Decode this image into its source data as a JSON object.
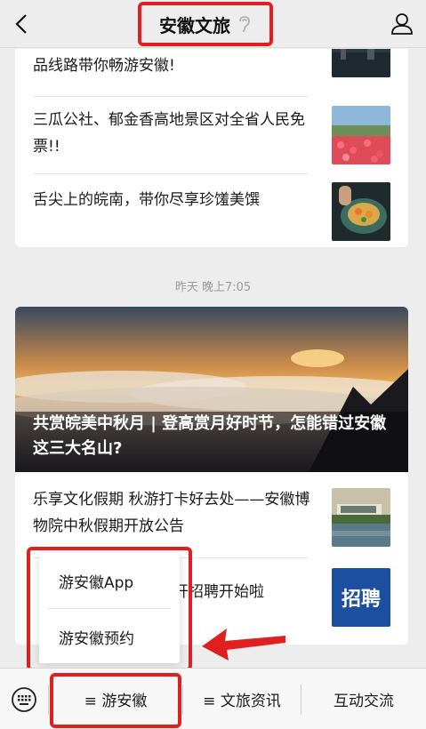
{
  "header": {
    "title": "安徽文旅",
    "back_icon": "chevron-left-icon",
    "ear_icon": "ear-icon",
    "profile_icon": "person-icon"
  },
  "card_top": {
    "items": [
      {
        "title": "品线路带你畅游安徽!"
      },
      {
        "title": "三瓜公社、郁金香高地景区对全省人民免票!!"
      },
      {
        "title": "舌尖上的皖南，带你尽享珍馐美馔"
      }
    ]
  },
  "timestamp": "昨天 晚上7:05",
  "card_main": {
    "hero_title": "共赏皖美中秋月 | 登高赏月好时节，怎能错过安徽这三大名山?",
    "items": [
      {
        "title": "乐享文化假期 秋游打卡好去处——安徽博物院中秋假期开放公告"
      },
      {
        "title": "馆公开招聘开始啦",
        "thumb_text": "招聘"
      }
    ]
  },
  "popup": {
    "items": [
      "游安徽App",
      "游安徽预约"
    ]
  },
  "bottombar": {
    "keyboard_icon": "keyboard-icon",
    "tabs": [
      "≡ 游安徽",
      "≡ 文旅资讯",
      "互动交流"
    ]
  },
  "colors": {
    "highlight": "#e02020",
    "background": "#ededed"
  }
}
